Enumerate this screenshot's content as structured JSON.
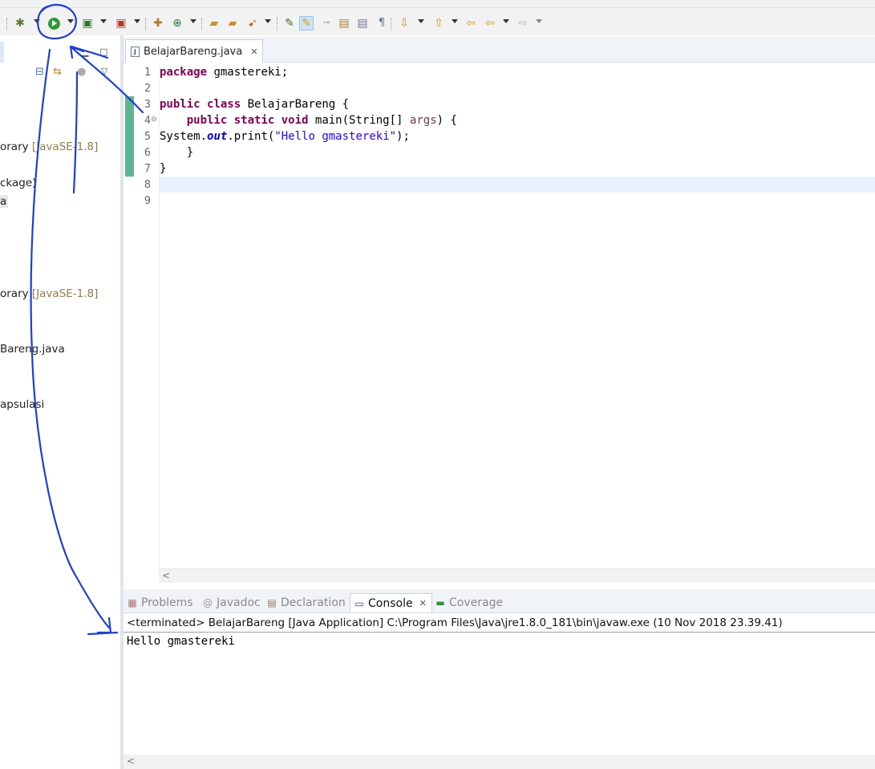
{
  "toolbar": {
    "icons": [
      "debug-icon",
      "run-icon",
      "coverage-icon",
      "external-tools-icon",
      "new-java-package-icon",
      "new-java-class-icon",
      "open-type-icon",
      "open-folder-icon",
      "search-icon",
      "toggle-mark-occurrences-icon",
      "toggle-highlight-icon",
      "show-whitespace-icon",
      "next-annotation-icon",
      "previous-annotation-icon",
      "back-icon",
      "forward-icon"
    ]
  },
  "package_explorer": {
    "items": [
      {
        "text": "orary ",
        "suffix": "[JavaSE-1.8]"
      },
      {
        "text": "ckage)",
        "suffix": ""
      },
      {
        "text": "a",
        "suffix": "",
        "selected": true
      },
      {
        "text": "orary ",
        "suffix": "[JavaSE-1.8]"
      },
      {
        "text": "Bareng.java",
        "suffix": ""
      },
      {
        "text": "apsulasi",
        "suffix": ""
      }
    ]
  },
  "editor": {
    "tab_label": "BelajarBareng.java",
    "line_numbers": [
      "1",
      "2",
      "3",
      "4",
      "5",
      "6",
      "7",
      "8",
      "9"
    ],
    "code": {
      "line1_kw": "package",
      "line1_rest": " gmastereki;",
      "line3_kw1": "public",
      "line3_kw2": "class",
      "line3_rest": " BelajarBareng {",
      "line4_indent": "    ",
      "line4_kw1": "public",
      "line4_kw2": "static",
      "line4_kw3": "void",
      "line4_mid": " main(String[] ",
      "line4_param": "args",
      "line4_end": ") {",
      "line5_pre": "System.",
      "line5_field": "out",
      "line5_mid": ".print(",
      "line5_str": "\"Hello gmastereki\"",
      "line5_end": ");",
      "line6": "    }",
      "line7": "}"
    }
  },
  "console": {
    "tabs": [
      {
        "label": "Problems",
        "icon": "problems-icon"
      },
      {
        "label": "Javadoc",
        "icon": "javadoc-icon"
      },
      {
        "label": "Declaration",
        "icon": "declaration-icon"
      },
      {
        "label": "Console",
        "icon": "console-icon",
        "active": true
      },
      {
        "label": "Coverage",
        "icon": "coverage-icon"
      }
    ],
    "status": "<terminated> BelajarBareng [Java Application] C:\\Program Files\\Java\\jre1.8.0_181\\bin\\javaw.exe (10 Nov 2018 23.39.41)",
    "output": "Hello gmastereki"
  },
  "colors": {
    "keyword": "#7f0055",
    "string": "#2a00ff",
    "field": "#0000c0",
    "annotation_ink": "#1f3fd1",
    "run_green": "#2e9a3a"
  }
}
